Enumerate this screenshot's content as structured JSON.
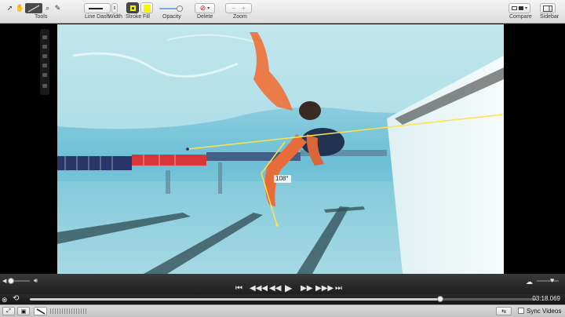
{
  "toolbar": {
    "groups": {
      "tools": "Tools",
      "line_dash": "Line Dash",
      "width": "Width",
      "stroke": "Stroke",
      "fill": "Fill",
      "opacity": "Opacity",
      "delete": "Delete",
      "zoom": "Zoom",
      "compare": "Compare",
      "sidebar": "Sidebar"
    },
    "colors": {
      "stroke": "#f5f500",
      "fill": "#f5f500"
    },
    "opacity_level": 0.7
  },
  "video": {
    "angle_annotation": "108°",
    "colors": {
      "annotation": "#ffe14a",
      "water": "#7cc7d9",
      "lane_red": "#d9383a"
    }
  },
  "transport": {
    "volume_level": 0.15,
    "playback_position": 0.81,
    "time": "03:18.069",
    "buttons": [
      "skip-back",
      "step-back-fast",
      "step-back",
      "play",
      "step-forward",
      "step-forward-fast",
      "skip-forward"
    ]
  },
  "bottom": {
    "sync_videos": "Sync Videos"
  }
}
